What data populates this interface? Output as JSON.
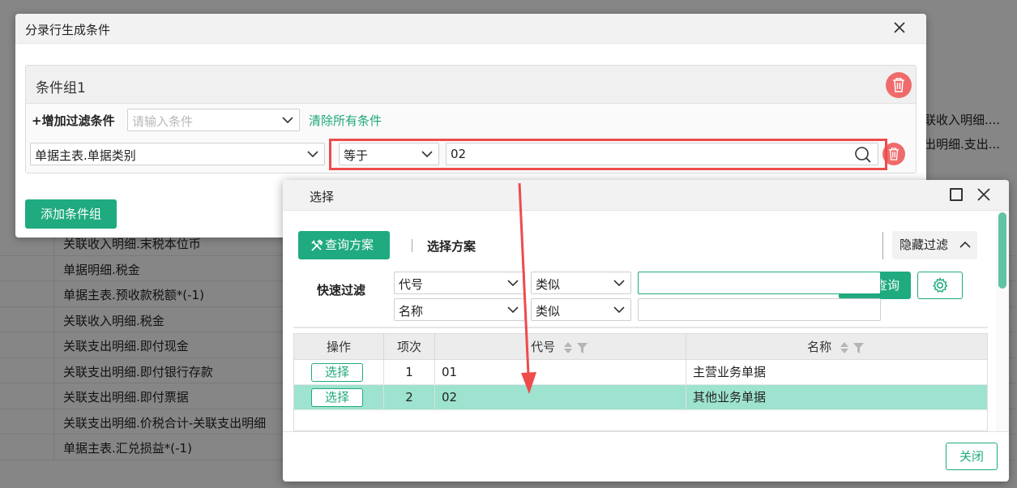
{
  "background": {
    "rows": [
      "关联收入明细.末税本位币",
      "单据明细.税金",
      "单据主表.预收款税额*(-1)",
      "关联收入明细.税金",
      "关联支出明细.即付现金",
      "关联支出明细.即付银行存款",
      "关联支出明细.即付票据",
      "关联支出明细.价税合计-关联支出明细",
      "单据主表.汇兑损益*(-1)"
    ],
    "right_cells": [
      "联收入明细....",
      "出明细.支出..."
    ]
  },
  "condition_dialog": {
    "title": "分录行生成条件",
    "group_title": "条件组1",
    "add_filter_label": "+增加过滤条件",
    "condition_placeholder": "请输入条件",
    "clear_all_label": "清除所有条件",
    "field_value": "单据主表.单据类别",
    "operator_value": "等于",
    "condition_value": "02",
    "add_group_label": "添加条件组",
    "colors": {
      "accent": "#1faa7f",
      "danger": "#ef6b6b",
      "highlight": "#ee4b4b"
    }
  },
  "select_dialog": {
    "title": "选择",
    "query_plan_label": "查询方案",
    "select_plan_label": "选择方案",
    "hide_filter_label": "隐藏过滤",
    "quick_filter_label": "快速过滤",
    "filters": [
      {
        "field": "代号",
        "operator": "类似",
        "value": ""
      },
      {
        "field": "名称",
        "operator": "类似",
        "value": ""
      }
    ],
    "query_label": "查询",
    "grid": {
      "columns": [
        "操作",
        "项次",
        "代号",
        "名称"
      ],
      "rows": [
        {
          "action": "选择",
          "index": "1",
          "code": "01",
          "name": "主营业务单据",
          "selected": false
        },
        {
          "action": "选择",
          "index": "2",
          "code": "02",
          "name": "其他业务单据",
          "selected": true
        }
      ]
    },
    "close_label": "关闭"
  }
}
